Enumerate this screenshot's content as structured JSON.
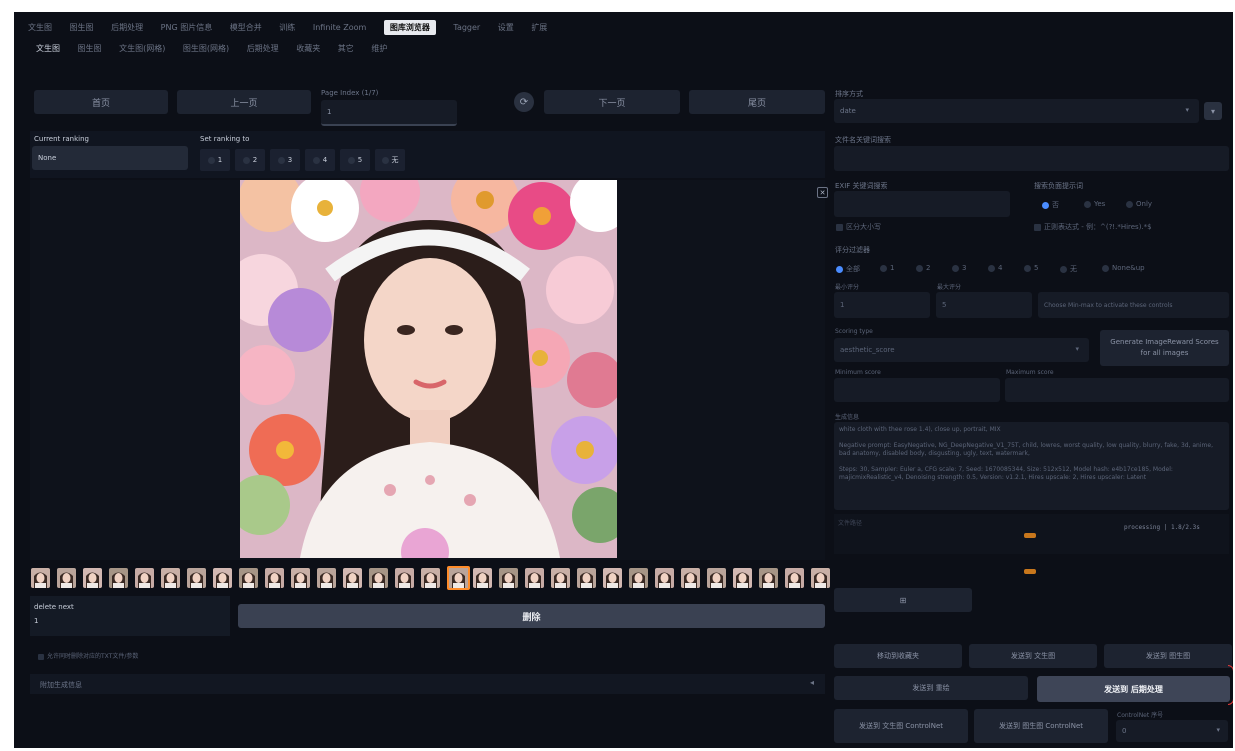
{
  "top_tabs": [
    "文生图",
    "图生图",
    "后期处理",
    "PNG 图片信息",
    "模型合并",
    "训练",
    "Infinite Zoom",
    "图库浏览器",
    "Tagger",
    "设置",
    "扩展"
  ],
  "active_top_tab": "图库浏览器",
  "sub_tabs": [
    "文生图",
    "图生图",
    "文生图(网格)",
    "图生图(网格)",
    "后期处理",
    "收藏夹",
    "其它",
    "维护"
  ],
  "nav": {
    "first": "首页",
    "prev": "上一页",
    "page_index_label": "Page Index (1/7)",
    "page_index_value": "1",
    "next": "下一页",
    "last": "尾页"
  },
  "ranking": {
    "current_label": "Current ranking",
    "current_value": "None",
    "set_label": "Set ranking to",
    "options": [
      "1",
      "2",
      "3",
      "4",
      "5",
      "无"
    ]
  },
  "delete": {
    "label": "delete next",
    "value": "1",
    "button": "删除",
    "checkbox_label": "允许同时删除对应的TXT文件/参数",
    "additional_info": "附加生成信息"
  },
  "right": {
    "sort_label": "排序方式",
    "sort_value": "date",
    "filename_search": "文件名关键词搜索",
    "exif_search": "EXIF 关键词搜索",
    "search_negative_label": "搜索负面提示词",
    "neg_options": [
      "否",
      "Yes",
      "Only"
    ],
    "case_sensitive": "区分大小写",
    "regex": "正则表达式 - 例：^(?!.*Hires).*$",
    "rank_filter": "评分过滤器",
    "rank_options": [
      "全部",
      "1",
      "2",
      "3",
      "4",
      "5",
      "无",
      "None&up"
    ],
    "min_score_label": "最小评分",
    "max_score_label": "最大评分",
    "min_score_value": "1",
    "max_score_value": "5",
    "score_hint": "Choose Min-max to activate these controls",
    "scoring_type_label": "Scoring type",
    "scoring_type_value": "aesthetic_score",
    "generate_button": "Generate ImageReward Scores for all images",
    "minimum_score": "Minimum score",
    "maximum_score": "Maximum score",
    "gen_info_label": "生成信息",
    "gen_info_lines": [
      "white cloth with thee rose 1.4), close up, portrait, MIX",
      "Negative prompt: EasyNegative, NG_DeepNegative_V1_75T, child, lowres, worst quality, low quality, blurry, fake, 3d, anime, bad anatomy, disabled body, disgusting, ugly, text, watermark,",
      "Steps: 30, Sampler: Euler a, CFG scale: 7, Seed: 1670085344, Size: 512x512, Model hash: e4b17ce185, Model: majicmixRealistic_v4, Denoising strength: 0.5, Version: v1.2.1, Hires upscale: 2, Hires upscaler: Latent"
    ],
    "path_label": "文件路径",
    "path_status": "processing | 1.8/2.3s",
    "send_small": "⊞",
    "btn_move": "移动到收藏夹",
    "btn_txt2img": "发送到 文生图",
    "btn_img2img": "发送到 图生图",
    "btn_inpaint": "发送到 重绘",
    "btn_extras": "发送到 后期处理",
    "btn_cn_txt2img": "发送到 文生图 ControlNet",
    "btn_cn_img2img": "发送到 图生图 ControlNet",
    "controlnet_label": "ControlNet 序号",
    "controlnet_value": "0"
  },
  "colors": {
    "background": "#0c0f17",
    "panel": "#161b26",
    "button": "#1d2330",
    "accent": "#4a8cff",
    "selected_border": "#ff8c2a"
  },
  "close_icon": "✕"
}
